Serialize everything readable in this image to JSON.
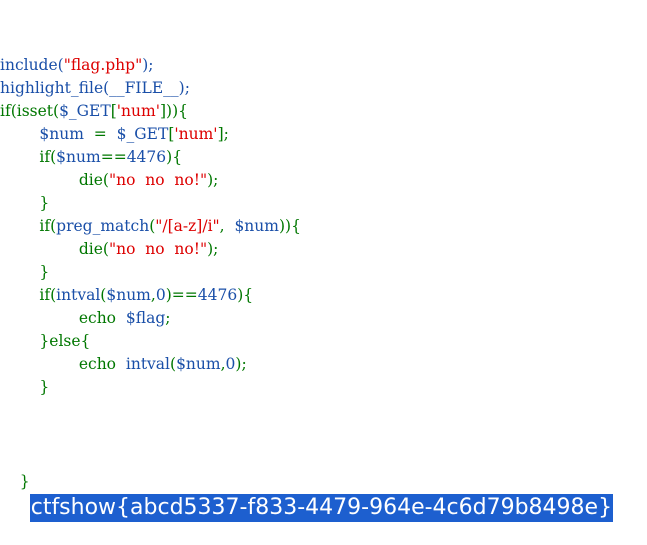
{
  "colors": {
    "default": "#1a4fa8",
    "string": "#dd0000",
    "keyword": "#007700",
    "selection_bg": "#1d5fcf",
    "selection_fg": "#ffffff"
  },
  "code_lines": [
    [
      [
        "default",
        "include("
      ],
      [
        "string",
        "\"flag.php\""
      ],
      [
        "default",
        ");"
      ]
    ],
    [
      [
        "default",
        "highlight_file("
      ],
      [
        "default",
        "__FILE__"
      ],
      [
        "default",
        ");"
      ]
    ],
    [
      [
        "keyword",
        "if(isset("
      ],
      [
        "default",
        "$_GET"
      ],
      [
        "keyword",
        "["
      ],
      [
        "string",
        "'num'"
      ],
      [
        "keyword",
        "])){"
      ]
    ],
    [
      [
        "plain",
        "        "
      ],
      [
        "default",
        "$num"
      ],
      [
        "keyword",
        "  =  "
      ],
      [
        "default",
        "$_GET"
      ],
      [
        "keyword",
        "["
      ],
      [
        "string",
        "'num'"
      ],
      [
        "keyword",
        "];"
      ]
    ],
    [
      [
        "plain",
        "        "
      ],
      [
        "keyword",
        "if("
      ],
      [
        "default",
        "$num"
      ],
      [
        "keyword",
        "=="
      ],
      [
        "default",
        "4476"
      ],
      [
        "keyword",
        "){"
      ]
    ],
    [
      [
        "plain",
        "                "
      ],
      [
        "keyword",
        "die("
      ],
      [
        "string",
        "\"no  no  no!\""
      ],
      [
        "keyword",
        ");"
      ]
    ],
    [
      [
        "plain",
        "        "
      ],
      [
        "keyword",
        "}"
      ]
    ],
    [
      [
        "plain",
        "        "
      ],
      [
        "keyword",
        "if("
      ],
      [
        "default",
        "preg_match"
      ],
      [
        "keyword",
        "("
      ],
      [
        "string",
        "\"/[a-z]/i\""
      ],
      [
        "keyword",
        ",  "
      ],
      [
        "default",
        "$num"
      ],
      [
        "keyword",
        ")){"
      ]
    ],
    [
      [
        "plain",
        "                "
      ],
      [
        "keyword",
        "die("
      ],
      [
        "string",
        "\"no  no  no!\""
      ],
      [
        "keyword",
        ");"
      ]
    ],
    [
      [
        "plain",
        "        "
      ],
      [
        "keyword",
        "}"
      ]
    ],
    [
      [
        "plain",
        "        "
      ],
      [
        "keyword",
        "if("
      ],
      [
        "default",
        "intval"
      ],
      [
        "keyword",
        "("
      ],
      [
        "default",
        "$num"
      ],
      [
        "keyword",
        ","
      ],
      [
        "default",
        "0"
      ],
      [
        "keyword",
        ")=="
      ],
      [
        "default",
        "4476"
      ],
      [
        "keyword",
        "){"
      ]
    ],
    [
      [
        "plain",
        "                "
      ],
      [
        "keyword",
        "echo  "
      ],
      [
        "default",
        "$flag"
      ],
      [
        "keyword",
        ";"
      ]
    ],
    [
      [
        "plain",
        "        "
      ],
      [
        "keyword",
        "}else{"
      ]
    ],
    [
      [
        "plain",
        "                "
      ],
      [
        "keyword",
        "echo  "
      ],
      [
        "default",
        "intval"
      ],
      [
        "keyword",
        "("
      ],
      [
        "default",
        "$num"
      ],
      [
        "keyword",
        ","
      ],
      [
        "default",
        "0"
      ],
      [
        "keyword",
        ");"
      ]
    ],
    [
      [
        "plain",
        "        "
      ],
      [
        "keyword",
        "}"
      ]
    ]
  ],
  "closing_brace": "}",
  "flag_output": "ctfshow{abcd5337-f833-4479-964e-4c6d79b8498e}"
}
